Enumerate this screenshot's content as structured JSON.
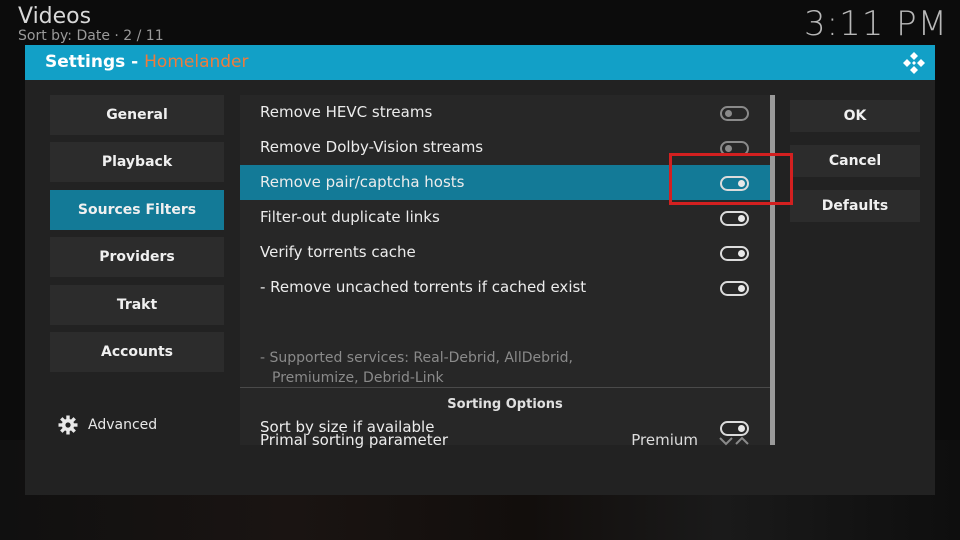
{
  "header": {
    "app_title": "Videos",
    "sort_info": "Sort by: Date  ·  2 / 11",
    "clock": "3:11 PM"
  },
  "dialog": {
    "title_prefix": "Settings - ",
    "profile": "Homelander",
    "icon": "kodi-logo-icon"
  },
  "sidebar": {
    "items": [
      {
        "label": "General"
      },
      {
        "label": "Playback"
      },
      {
        "label": "Sources Filters",
        "active": true
      },
      {
        "label": "Providers"
      },
      {
        "label": "Trakt"
      },
      {
        "label": "Accounts"
      }
    ],
    "advanced_label": "Advanced",
    "advanced_icon": "gear-icon"
  },
  "settings": {
    "rows": [
      {
        "label": "Remove HEVC streams",
        "enabled": false
      },
      {
        "label": "Remove Dolby-Vision streams",
        "enabled": false
      },
      {
        "label": "Remove pair/captcha hosts",
        "enabled": true,
        "focused": true
      },
      {
        "label": "Filter-out duplicate links",
        "enabled": true
      },
      {
        "label": "Verify torrents cache",
        "enabled": true
      },
      {
        "label": "- Remove uncached torrents if cached exist",
        "enabled": true
      }
    ],
    "note_line1": "- Supported services: Real-Debrid, AllDebrid,",
    "note_line2": "Premiumize, Debrid-Link",
    "section_title": "Sorting Options",
    "sorting_rows": [
      {
        "label": "Primal sorting parameter",
        "value": "Premium"
      },
      {
        "label": "Sort by size if available",
        "enabled": true
      }
    ]
  },
  "buttons": {
    "ok": "OK",
    "cancel": "Cancel",
    "defaults": "Defaults"
  },
  "colors": {
    "header_accent": "#12a0c7",
    "active_item": "#137a97",
    "profile_name": "#f07b3b",
    "annotation_box": "#d32020"
  }
}
